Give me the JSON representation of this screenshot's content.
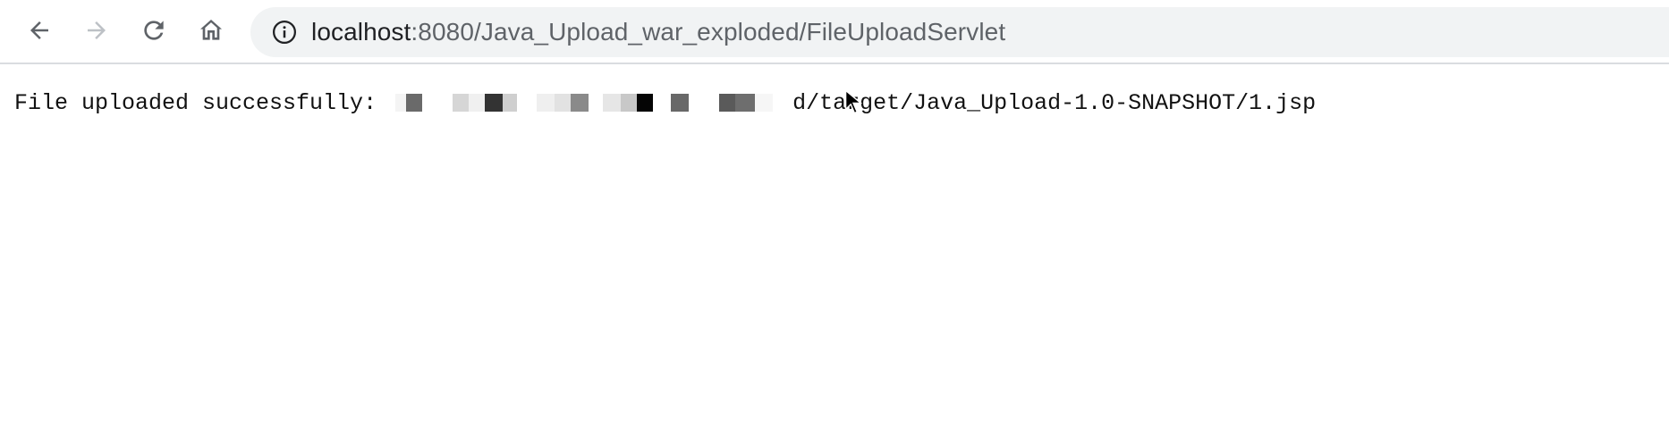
{
  "browser": {
    "nav": {
      "back_icon": "arrow-left-icon",
      "forward_icon": "arrow-right-icon",
      "reload_icon": "reload-icon",
      "home_icon": "home-icon"
    },
    "omnibox": {
      "icon": "info-icon",
      "host": "localhost",
      "path": ":8080/Java_Upload_war_exploded/FileUploadServlet"
    }
  },
  "page": {
    "message_prefix": "File uploaded successfully: ",
    "message_suffix": "d/target/Java_Upload-1.0-SNAPSHOT/1.jsp"
  }
}
